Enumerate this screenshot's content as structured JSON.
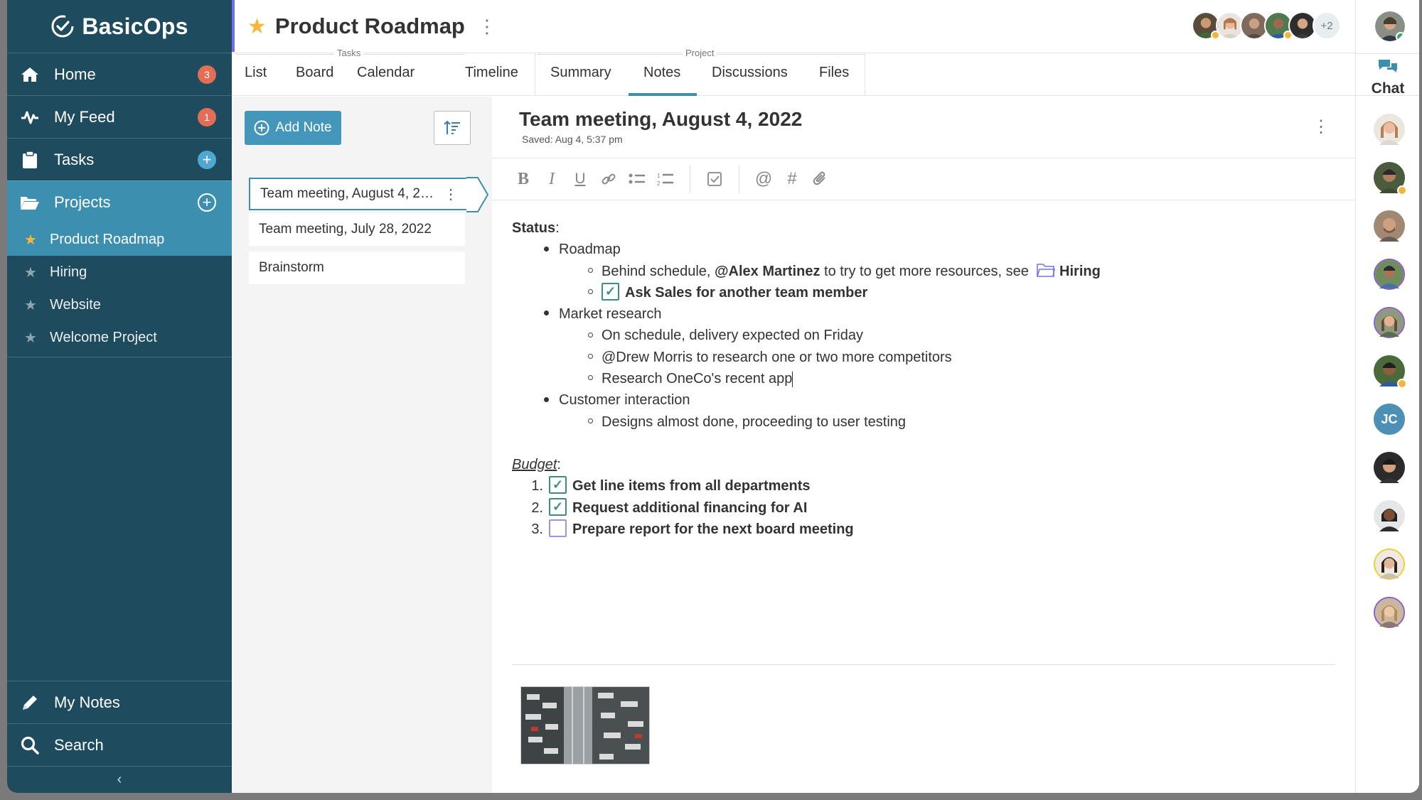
{
  "app": {
    "name": "BasicOps"
  },
  "sidebar": {
    "nav": [
      {
        "label": "Home",
        "icon": "home-icon",
        "badge": "3"
      },
      {
        "label": "My Feed",
        "icon": "activity-icon",
        "badge": "1"
      },
      {
        "label": "Tasks",
        "icon": "clipboard-icon"
      },
      {
        "label": "Projects",
        "icon": "folder-open-icon"
      }
    ],
    "projects": [
      {
        "label": "Product Roadmap",
        "active": true
      },
      {
        "label": "Hiring"
      },
      {
        "label": "Website"
      },
      {
        "label": "Welcome Project"
      }
    ],
    "bottom": [
      {
        "label": "My Notes",
        "icon": "pencil-icon"
      },
      {
        "label": "Search",
        "icon": "search-icon"
      }
    ],
    "collapse": "‹"
  },
  "header": {
    "title": "Product Roadmap",
    "more_avatars": "+2"
  },
  "tabs": {
    "tasks_group_label": "Tasks",
    "project_group_label": "Project",
    "items": [
      "List",
      "Board",
      "Calendar",
      "Timeline",
      "Summary",
      "Notes",
      "Discussions",
      "Files"
    ],
    "active": "Notes"
  },
  "notes_list": {
    "add_label": "Add Note",
    "items": [
      {
        "title": "Team meeting, August 4, 2022",
        "selected": true
      },
      {
        "title": "Team meeting, July 28, 2022"
      },
      {
        "title": "Brainstorm"
      }
    ]
  },
  "note": {
    "title": "Team meeting, August 4, 2022",
    "saved": "Saved: Aug 4, 5:37 pm",
    "status_heading": "Status",
    "status_items": [
      {
        "text": "Roadmap"
      },
      {
        "text": "Market research"
      },
      {
        "text": "Customer interaction"
      }
    ],
    "roadmap_sub1_pre": "Behind schedule, ",
    "roadmap_sub1_mention": "@Alex Martinez",
    "roadmap_sub1_post": " to try to get more resources, see",
    "roadmap_sub1_folder": "Hiring",
    "roadmap_sub2": "Ask Sales for another team member",
    "market_sub": [
      "On schedule, delivery expected on Friday",
      "@Drew Morris to research one or two more competitors",
      "Research OneCo's recent app"
    ],
    "customer_sub": "Designs almost done, proceeding to user testing",
    "budget_heading": "Budget",
    "budget_items": [
      {
        "num": "1.",
        "text": "Get line items from all departments",
        "checked": true
      },
      {
        "num": "2.",
        "text": "Request additional financing for AI",
        "checked": true
      },
      {
        "num": "3.",
        "text": "Prepare report for the next board meeting",
        "checked": false
      }
    ]
  },
  "chat": {
    "label": "Chat",
    "initials": "JC"
  },
  "colors": {
    "sidebar": "#1f4b5e",
    "active": "#3d8fb0",
    "badge": "#e46d56",
    "star": "#f6b73c",
    "check": "#3a8f80"
  }
}
